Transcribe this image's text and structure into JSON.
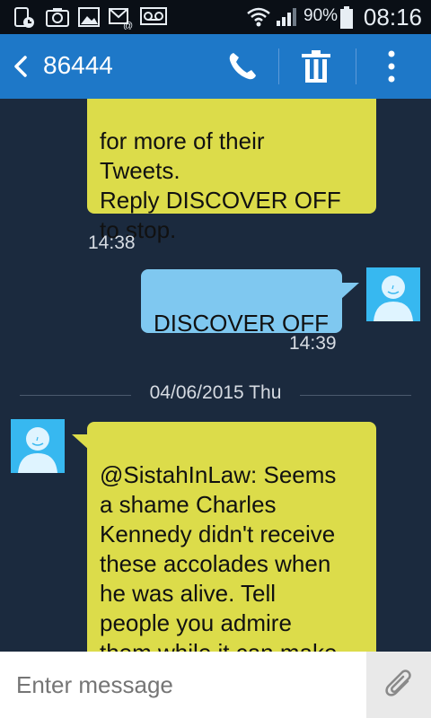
{
  "status": {
    "battery": "90%",
    "time": "08:16"
  },
  "header": {
    "contact": "86444"
  },
  "messages": {
    "m1": {
      "text": "for more of their\nTweets.\nReply DISCOVER OFF\nto stop.",
      "time": "14:38"
    },
    "m2": {
      "text": "DISCOVER OFF",
      "time": "14:39"
    },
    "date_divider": "04/06/2015 Thu",
    "m3": {
      "text": "@SistahInLaw: Seems\na shame Charles\nKennedy didn't receive\nthese accolades when\nhe was alive. Tell\npeople you admire\nthem while it can make\na difference."
    }
  },
  "composer": {
    "placeholder": "Enter message"
  },
  "icons": {
    "back": "chevron-left-icon",
    "call": "phone-icon",
    "delete": "trash-icon",
    "more": "overflow-menu-icon",
    "attach": "paperclip-icon",
    "avatar": "person-avatar-icon"
  },
  "colors": {
    "app_bar": "#1e78c8",
    "conversation_bg": "#1b2a3e",
    "incoming_bubble": "#dcdc4a",
    "outgoing_bubble": "#7fc8f0",
    "avatar": "#37b8f0"
  }
}
